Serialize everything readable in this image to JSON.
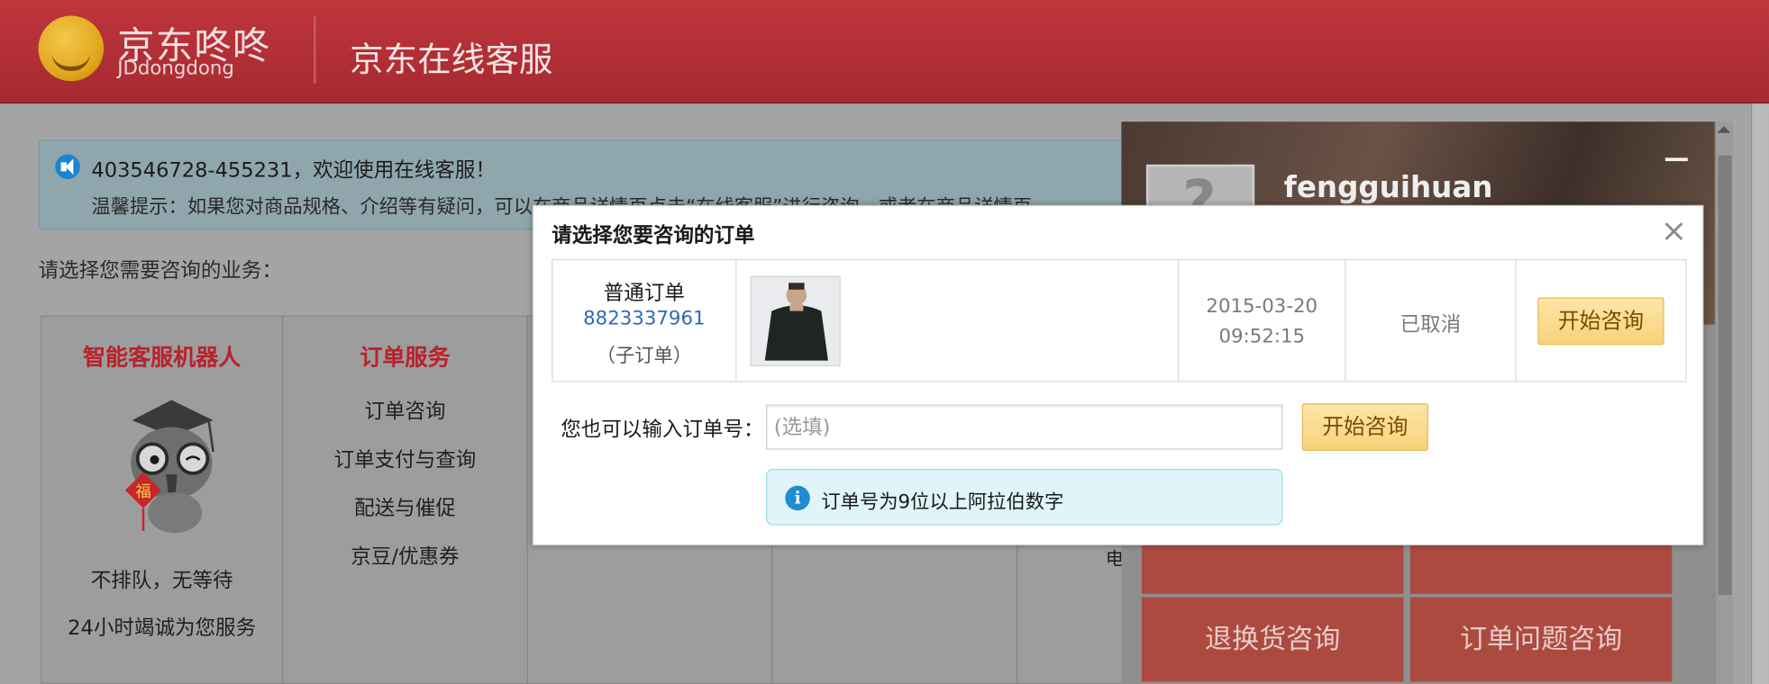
{
  "header": {
    "logo_cn": "京东咚咚",
    "logo_en": "JDdongdong",
    "title": "京东在线客服"
  },
  "notice": {
    "welcome": "403546728-455231，欢迎使用在线客服！",
    "tip": "温馨提示：如果您对商品规格、介绍等有疑问，可以在商品详情页点击“在线客服”进行咨询，或者在商品详情页"
  },
  "business_label": "请选择您需要咨询的业务：",
  "cards": {
    "robot": {
      "title": "智能客服机器人",
      "line1": "不排队，无等待",
      "line2": "24小时竭诚为您服务"
    },
    "order": {
      "title": "订单服务",
      "items": [
        "订单咨询",
        "订单支付与查询",
        "配送与催促",
        "京豆/优惠券"
      ]
    },
    "cut_text": "电"
  },
  "right_panel": {
    "username": "fengguihuan",
    "tiles": [
      "退换货咨询",
      "订单问题咨询"
    ]
  },
  "modal": {
    "title": "请选择您要咨询的订单",
    "close": "×",
    "order": {
      "type": "普通订单",
      "number": "8823337961",
      "sub": "（子订单）",
      "date": "2015-03-20",
      "time": "09:52:15",
      "status": "已取消",
      "button": "开始咨询"
    },
    "input_label": "您也可以输入订单号：",
    "input_placeholder": "(选填)",
    "input_button": "开始咨询",
    "hint": "订单号为9位以上阿拉伯数字"
  }
}
